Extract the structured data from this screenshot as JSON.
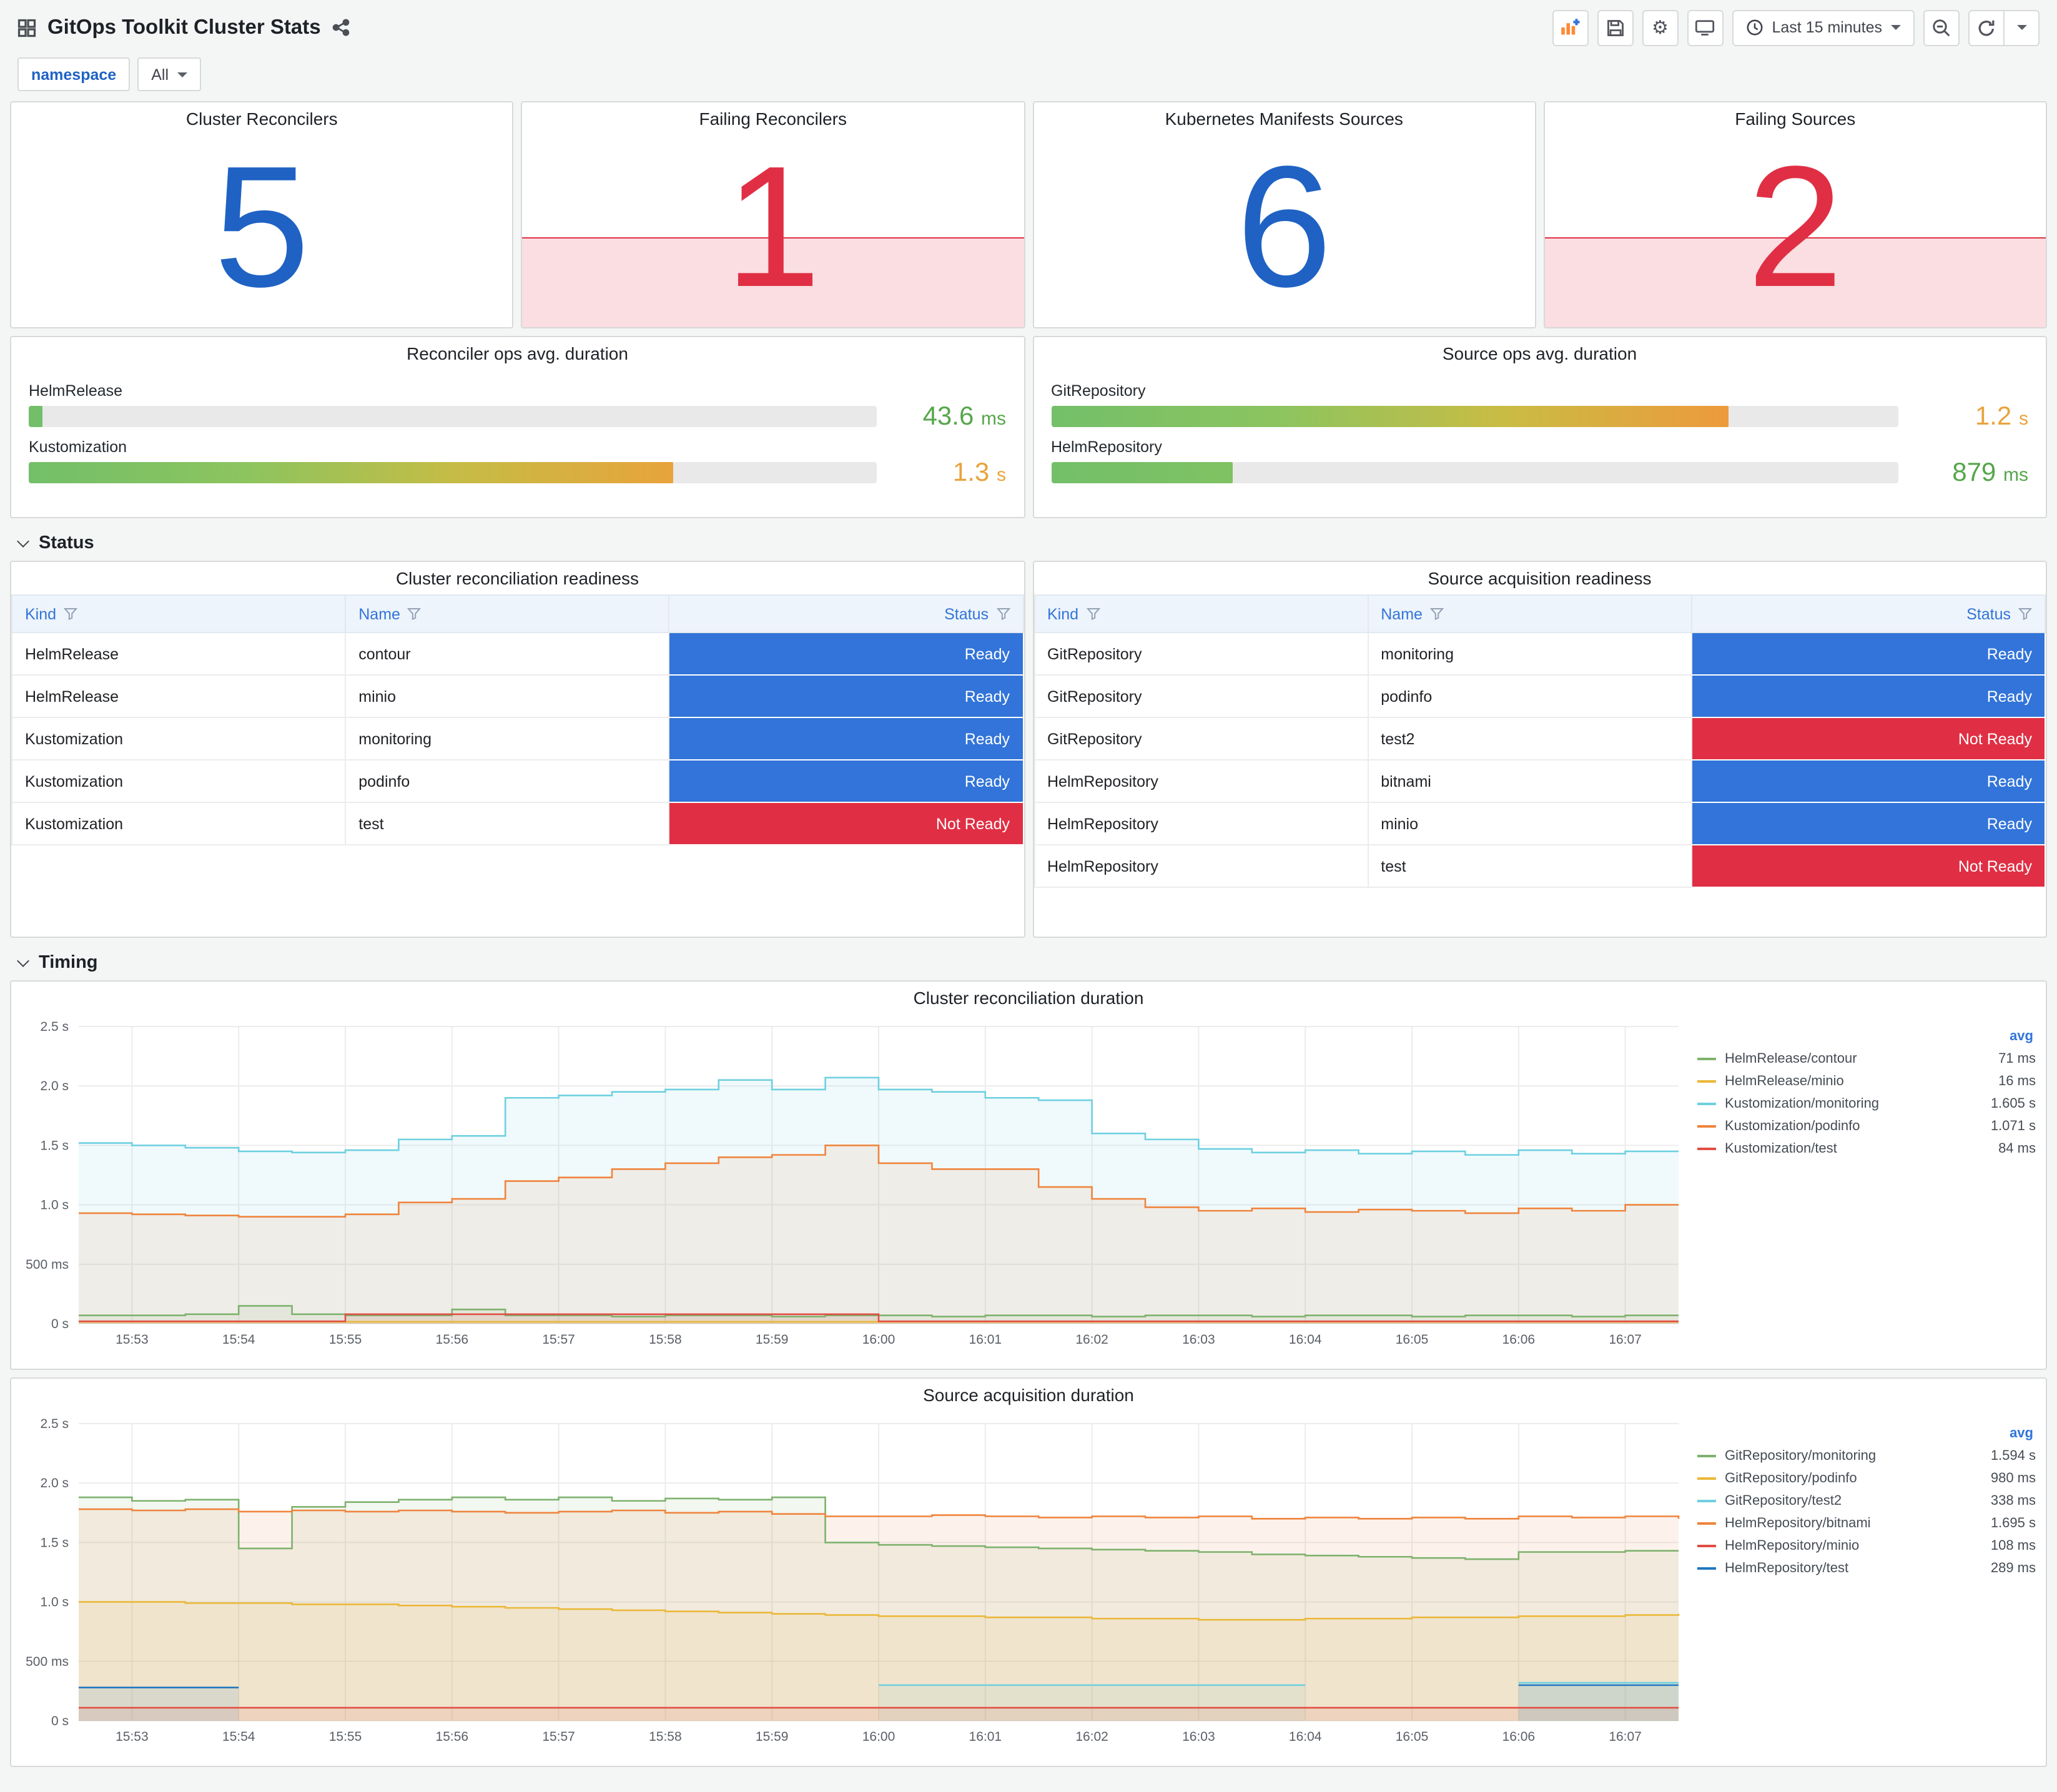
{
  "header": {
    "title": "GitOps Toolkit Cluster Stats",
    "time_range_label": "Last 15 minutes"
  },
  "filters": {
    "namespace_label": "namespace",
    "namespace_value": "All"
  },
  "icons": {
    "gear": "⚙"
  },
  "stats": [
    {
      "title": "Cluster Reconcilers",
      "value": "5",
      "color": "#1f62c4",
      "failing": false
    },
    {
      "title": "Failing Reconcilers",
      "value": "1",
      "color": "#e02f44",
      "failing": true
    },
    {
      "title": "Kubernetes Manifests Sources",
      "value": "6",
      "color": "#1f62c4",
      "failing": false
    },
    {
      "title": "Failing Sources",
      "value": "2",
      "color": "#e02f44",
      "failing": true
    }
  ],
  "gauges": [
    {
      "title": "Reconciler ops avg. duration",
      "rows": [
        {
          "label": "HelmRelease",
          "pct": 1.6,
          "value": "43.6",
          "unit": "ms",
          "value_color": "#56a64b",
          "bar_colors": [
            "#73bf69",
            "#73bf69"
          ]
        },
        {
          "label": "Kustomization",
          "pct": 76,
          "value": "1.3",
          "unit": "s",
          "value_color": "#e8a33c",
          "bar_colors": [
            "#73bf69",
            "#8cc45f",
            "#c6bc45",
            "#e8a33c"
          ]
        }
      ]
    },
    {
      "title": "Source ops avg. duration",
      "rows": [
        {
          "label": "GitRepository",
          "pct": 80,
          "value": "1.2",
          "unit": "s",
          "value_color": "#e8a33c",
          "bar_colors": [
            "#73bf69",
            "#8cc45f",
            "#c9bc44",
            "#ed9a3c"
          ]
        },
        {
          "label": "HelmRepository",
          "pct": 21.5,
          "value": "879",
          "unit": "ms",
          "value_color": "#56a64b",
          "bar_colors": [
            "#73bf69",
            "#7fc263"
          ]
        }
      ]
    }
  ],
  "sections": {
    "status": "Status",
    "timing": "Timing"
  },
  "status_colors": {
    "Ready": "#3274d9",
    "Not Ready": "#e02f44"
  },
  "tables": [
    {
      "title": "Cluster reconciliation readiness",
      "columns": [
        "Kind",
        "Name",
        "Status"
      ],
      "rows": [
        {
          "kind": "HelmRelease",
          "name": "contour",
          "status": "Ready"
        },
        {
          "kind": "HelmRelease",
          "name": "minio",
          "status": "Ready"
        },
        {
          "kind": "Kustomization",
          "name": "monitoring",
          "status": "Ready"
        },
        {
          "kind": "Kustomization",
          "name": "podinfo",
          "status": "Ready"
        },
        {
          "kind": "Kustomization",
          "name": "test",
          "status": "Not Ready"
        }
      ]
    },
    {
      "title": "Source acquisition readiness",
      "columns": [
        "Kind",
        "Name",
        "Status"
      ],
      "rows": [
        {
          "kind": "GitRepository",
          "name": "monitoring",
          "status": "Ready"
        },
        {
          "kind": "GitRepository",
          "name": "podinfo",
          "status": "Ready"
        },
        {
          "kind": "GitRepository",
          "name": "test2",
          "status": "Not Ready"
        },
        {
          "kind": "HelmRepository",
          "name": "bitnami",
          "status": "Ready"
        },
        {
          "kind": "HelmRepository",
          "name": "minio",
          "status": "Ready"
        },
        {
          "kind": "HelmRepository",
          "name": "test",
          "status": "Not Ready"
        }
      ]
    }
  ],
  "chart_data": [
    {
      "type": "area",
      "title": "Cluster reconciliation duration",
      "ylabel": "duration",
      "ylim": [
        0,
        2.5
      ],
      "yticks": [
        {
          "v": 0,
          "label": "0 s"
        },
        {
          "v": 0.5,
          "label": "500 ms"
        },
        {
          "v": 1.0,
          "label": "1.0 s"
        },
        {
          "v": 1.5,
          "label": "1.5 s"
        },
        {
          "v": 2.0,
          "label": "2.0 s"
        },
        {
          "v": 2.5,
          "label": "2.5 s"
        }
      ],
      "x_step_minutes": 0.5,
      "x_range_minutes": [
        0,
        15
      ],
      "xtick_labels": [
        "15:53",
        "15:54",
        "15:55",
        "15:56",
        "15:57",
        "15:58",
        "15:59",
        "16:00",
        "16:01",
        "16:02",
        "16:03",
        "16:04",
        "16:05",
        "16:06",
        "16:07"
      ],
      "legend_header": "avg",
      "series": [
        {
          "name": "HelmRelease/contour",
          "color": "#7eb26d",
          "avg": "71 ms",
          "values": [
            0.07,
            0.07,
            0.08,
            0.15,
            0.08,
            0.07,
            0.07,
            0.12,
            0.07,
            0.07,
            0.06,
            0.07,
            0.07,
            0.06,
            0.07,
            0.07,
            0.06,
            0.07,
            0.07,
            0.06,
            0.07,
            0.07,
            0.06,
            0.07,
            0.07,
            0.06,
            0.07,
            0.07,
            0.06,
            0.07,
            0.07
          ]
        },
        {
          "name": "HelmRelease/minio",
          "color": "#eab839",
          "avg": "16 ms",
          "values": [
            0.016,
            0.016,
            0.016,
            0.016,
            0.016,
            0.016,
            0.016,
            0.016,
            0.016,
            0.016,
            0.016,
            0.016,
            0.016,
            0.016,
            0.016,
            0.016,
            0.016,
            0.016,
            0.016,
            0.016,
            0.016,
            0.016,
            0.016,
            0.016,
            0.016,
            0.016,
            0.016,
            0.016,
            0.016,
            0.016,
            0.016
          ]
        },
        {
          "name": "Kustomization/monitoring",
          "color": "#6ed0e0",
          "avg": "1.605 s",
          "values": [
            1.52,
            1.5,
            1.48,
            1.45,
            1.44,
            1.46,
            1.55,
            1.58,
            1.9,
            1.92,
            1.95,
            1.97,
            2.05,
            1.97,
            2.07,
            1.97,
            1.95,
            1.9,
            1.88,
            1.6,
            1.55,
            1.47,
            1.44,
            1.46,
            1.43,
            1.45,
            1.42,
            1.46,
            1.43,
            1.45,
            1.45
          ]
        },
        {
          "name": "Kustomization/podinfo",
          "color": "#ef843c",
          "avg": "1.071 s",
          "values": [
            0.93,
            0.92,
            0.91,
            0.9,
            0.9,
            0.92,
            1.02,
            1.05,
            1.2,
            1.23,
            1.3,
            1.35,
            1.4,
            1.42,
            1.5,
            1.35,
            1.3,
            1.3,
            1.15,
            1.05,
            0.98,
            0.95,
            0.97,
            0.94,
            0.96,
            0.95,
            0.93,
            0.97,
            0.95,
            1.0,
            1.0
          ]
        },
        {
          "name": "Kustomization/test",
          "color": "#e24d42",
          "avg": "84 ms",
          "values": [
            0.02,
            0.02,
            0.02,
            0.02,
            0.02,
            0.08,
            0.08,
            0.08,
            0.08,
            0.08,
            0.08,
            0.08,
            0.08,
            0.08,
            0.08,
            0.02,
            0.02,
            0.02,
            0.02,
            0.02,
            0.02,
            0.02,
            0.02,
            0.02,
            0.02,
            0.02,
            0.02,
            0.02,
            0.02,
            0.02,
            0.02
          ]
        }
      ]
    },
    {
      "type": "area",
      "title": "Source acquisition duration",
      "ylabel": "duration",
      "ylim": [
        0,
        2.5
      ],
      "yticks": [
        {
          "v": 0,
          "label": "0 s"
        },
        {
          "v": 0.5,
          "label": "500 ms"
        },
        {
          "v": 1.0,
          "label": "1.0 s"
        },
        {
          "v": 1.5,
          "label": "1.5 s"
        },
        {
          "v": 2.0,
          "label": "2.0 s"
        },
        {
          "v": 2.5,
          "label": "2.5 s"
        }
      ],
      "x_step_minutes": 0.5,
      "x_range_minutes": [
        0,
        15
      ],
      "xtick_labels": [
        "15:53",
        "15:54",
        "15:55",
        "15:56",
        "15:57",
        "15:58",
        "15:59",
        "16:00",
        "16:01",
        "16:02",
        "16:03",
        "16:04",
        "16:05",
        "16:06",
        "16:07"
      ],
      "legend_header": "avg",
      "series": [
        {
          "name": "GitRepository/monitoring",
          "color": "#7eb26d",
          "avg": "1.594 s",
          "values": [
            1.88,
            1.85,
            1.86,
            1.45,
            1.8,
            1.84,
            1.86,
            1.88,
            1.86,
            1.88,
            1.85,
            1.87,
            1.86,
            1.88,
            1.5,
            1.48,
            1.47,
            1.46,
            1.45,
            1.44,
            1.43,
            1.42,
            1.4,
            1.39,
            1.38,
            1.37,
            1.36,
            1.42,
            1.42,
            1.43,
            1.43
          ]
        },
        {
          "name": "GitRepository/podinfo",
          "color": "#eab839",
          "avg": "980 ms",
          "values": [
            1.0,
            1.0,
            0.99,
            0.99,
            0.98,
            0.98,
            0.97,
            0.96,
            0.95,
            0.94,
            0.93,
            0.92,
            0.91,
            0.9,
            0.89,
            0.88,
            0.88,
            0.87,
            0.87,
            0.86,
            0.86,
            0.85,
            0.85,
            0.86,
            0.86,
            0.87,
            0.87,
            0.88,
            0.88,
            0.89,
            0.9
          ]
        },
        {
          "name": "GitRepository/test2",
          "color": "#6ed0e0",
          "avg": "338 ms",
          "values": [
            null,
            null,
            null,
            null,
            null,
            null,
            null,
            null,
            null,
            null,
            null,
            null,
            null,
            null,
            null,
            0.3,
            0.3,
            0.3,
            0.3,
            0.3,
            0.3,
            0.3,
            0.3,
            0.3,
            null,
            null,
            null,
            0.32,
            0.32,
            0.32,
            0.32
          ]
        },
        {
          "name": "HelmRepository/bitnami",
          "color": "#ef843c",
          "avg": "1.695 s",
          "values": [
            1.78,
            1.77,
            1.78,
            1.76,
            1.77,
            1.76,
            1.77,
            1.76,
            1.75,
            1.76,
            1.77,
            1.75,
            1.76,
            1.74,
            1.72,
            1.72,
            1.73,
            1.72,
            1.71,
            1.72,
            1.71,
            1.72,
            1.7,
            1.71,
            1.7,
            1.71,
            1.7,
            1.72,
            1.71,
            1.72,
            1.7
          ]
        },
        {
          "name": "HelmRepository/minio",
          "color": "#e24d42",
          "avg": "108 ms",
          "values": [
            0.11,
            0.11,
            0.11,
            0.11,
            0.11,
            0.11,
            0.11,
            0.11,
            0.11,
            0.11,
            0.11,
            0.11,
            0.11,
            0.11,
            0.11,
            0.11,
            0.11,
            0.11,
            0.11,
            0.11,
            0.11,
            0.11,
            0.11,
            0.11,
            0.11,
            0.11,
            0.11,
            0.11,
            0.11,
            0.11,
            0.11
          ]
        },
        {
          "name": "HelmRepository/test",
          "color": "#1f78c1",
          "avg": "289 ms",
          "values": [
            0.28,
            0.28,
            0.28,
            0.28,
            null,
            null,
            null,
            null,
            null,
            null,
            null,
            null,
            null,
            null,
            null,
            null,
            null,
            null,
            null,
            null,
            null,
            null,
            null,
            null,
            null,
            null,
            null,
            0.3,
            0.3,
            0.3,
            0.3
          ]
        }
      ]
    }
  ]
}
